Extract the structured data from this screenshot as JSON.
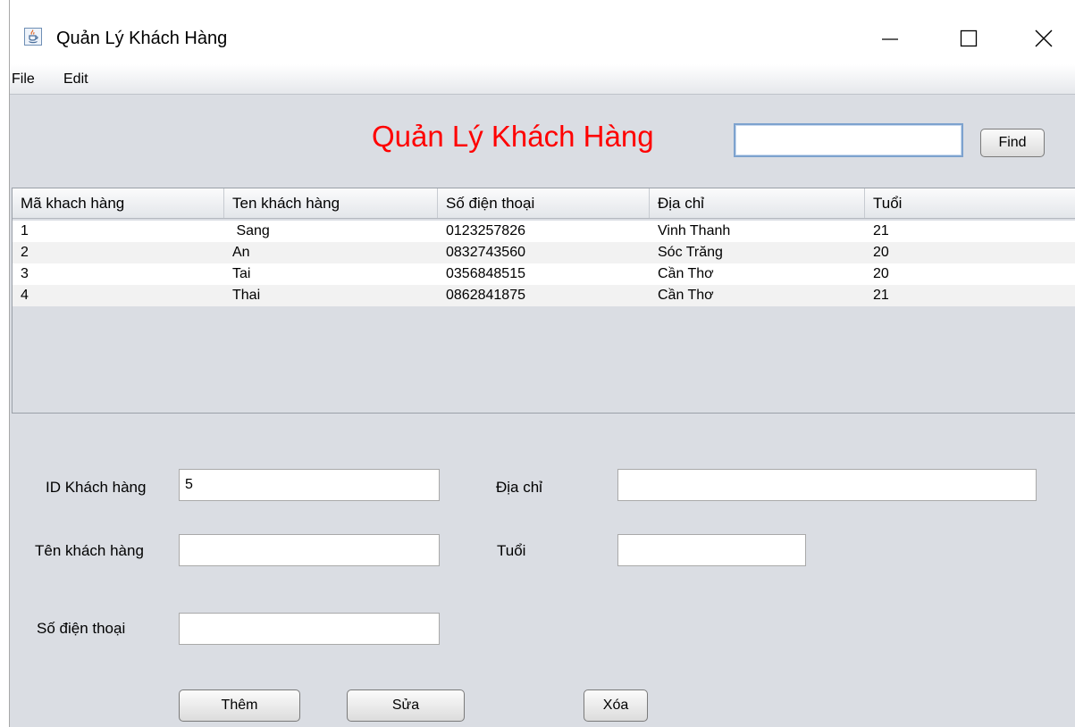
{
  "window": {
    "title": "Quản Lý Khách Hàng",
    "icons": {
      "app": "java-app-icon",
      "minimize": "minimize-icon",
      "maximize": "maximize-icon",
      "close": "close-icon"
    }
  },
  "menu": {
    "file": "File",
    "edit": "Edit"
  },
  "header": {
    "heading": "Quản Lý Khách Hàng",
    "search_value": "",
    "find_label": "Find",
    "heading_color": "#ff0000"
  },
  "table": {
    "columns": [
      "Mã khach hàng",
      "Ten khách hàng",
      "Số điện thoại",
      "Địa chỉ",
      "Tuổi"
    ],
    "rows": [
      [
        "1",
        " Sang",
        "0123257826",
        "Vinh Thanh",
        "21"
      ],
      [
        "2",
        "An",
        "0832743560",
        "Sóc Trăng",
        "20"
      ],
      [
        "3",
        "Tai",
        "0356848515",
        "Cần Thơ",
        "20"
      ],
      [
        "4",
        "Thai",
        "0862841875",
        "Cần Thơ",
        "21"
      ]
    ]
  },
  "form": {
    "id_label": "ID Khách hàng",
    "id_value": "5",
    "name_label": "Tên khách hàng",
    "name_value": "",
    "phone_label": "Số điện thoại",
    "phone_value": "",
    "address_label": "Địa chỉ",
    "address_value": "",
    "age_label": "Tuổi",
    "age_value": ""
  },
  "actions": {
    "add": "Thêm",
    "edit": "Sửa",
    "delete": "Xóa"
  }
}
